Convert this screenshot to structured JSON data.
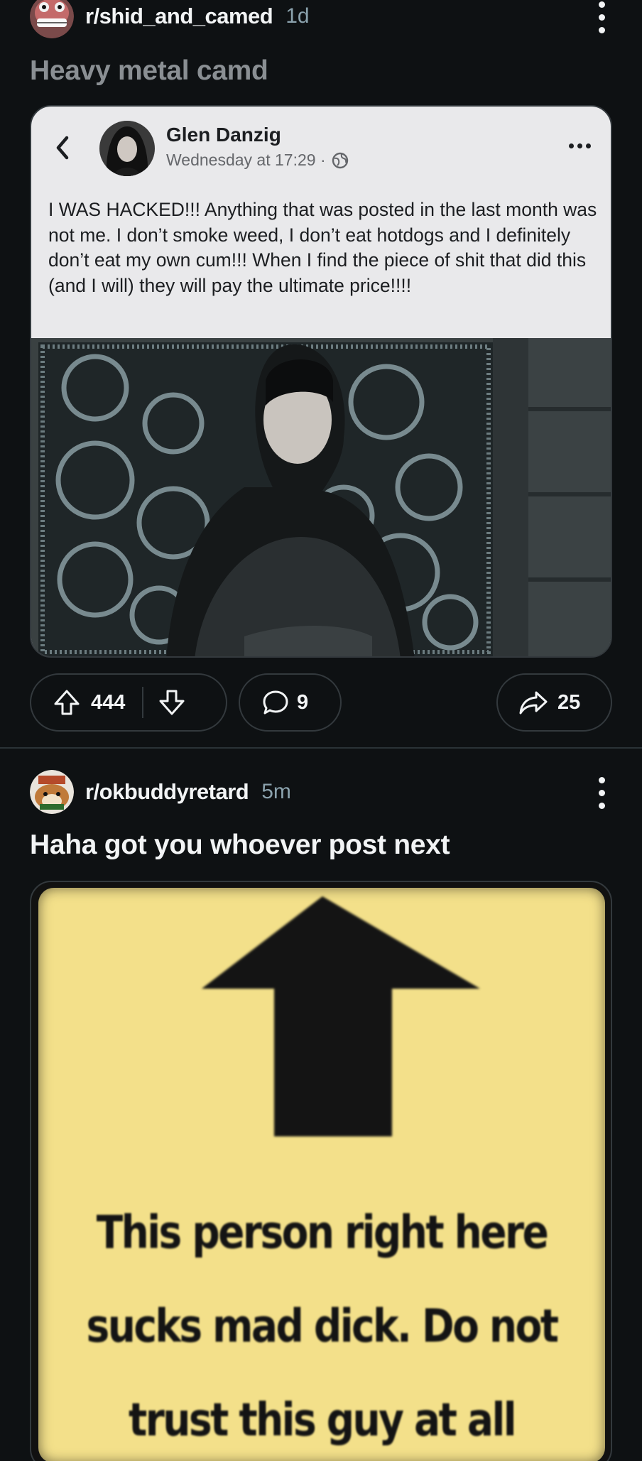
{
  "posts": [
    {
      "subreddit": "r/shid_and_camed",
      "age": "1d",
      "title": "Heavy metal camd",
      "embedded_post": {
        "author": "Glen Danzig",
        "timestamp": "Wednesday at 17:29 ·",
        "body": "I WAS HACKED!!! Anything that was posted in the last month was not me. I don’t smoke weed, I don’t eat hotdogs and I definitely don’t eat my own cum!!!  When I find the piece of shit that did this (and I will) they will pay the ultimate price!!!!"
      },
      "upvotes": "444",
      "comments": "9",
      "shares": "25"
    },
    {
      "subreddit": "r/okbuddyretard",
      "age": "5m",
      "title": "Haha got you whoever post next",
      "image_sign": {
        "line1": "This person right here",
        "line2": "sucks mad dick. Do not",
        "line3": "trust this guy at all"
      }
    }
  ],
  "colors": {
    "background": "#0e1113",
    "meta_text": "#8ba2ad",
    "title_muted": "#8a8f93",
    "sign_yellow": "#f3e08a"
  }
}
